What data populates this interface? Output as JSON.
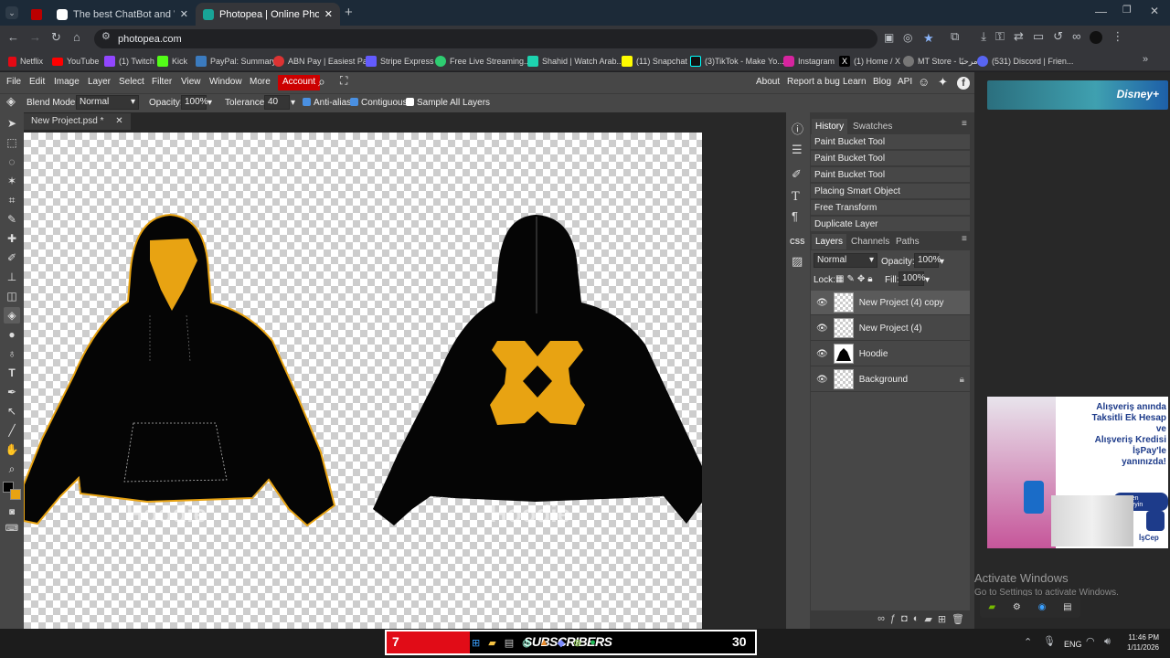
{
  "browser": {
    "tabs": [
      {
        "title": "The best ChatBot and Widgets"
      },
      {
        "title": "Photopea | Online Photo Editor"
      }
    ],
    "url": "photopea.com",
    "bookmarks": [
      "Netflix",
      "YouTube",
      "(1) Twitch",
      "Kick",
      "PayPal: Summary",
      "ABN Pay | Easiest Pa...",
      "Stripe Express",
      "Free Live Streaming...",
      "Shahid | Watch Arab...",
      "(11) Snapchat",
      "(3)TikTok - Make Yo...",
      "Instagram",
      "(1) Home / X",
      "MT Store - مرحبًا",
      "(531) Discord | Frien..."
    ]
  },
  "app": {
    "menu": [
      "File",
      "Edit",
      "Image",
      "Layer",
      "Select",
      "Filter",
      "View",
      "Window",
      "More"
    ],
    "account_label": "Account",
    "right_menu": [
      "About",
      "Report a bug",
      "Learn",
      "Blog",
      "API"
    ],
    "options": {
      "blend_label": "Blend Mode:",
      "blend_value": "Normal",
      "opacity_label": "Opacity:",
      "opacity_value": "100%",
      "tolerance_label": "Tolerance:",
      "tolerance_value": "40",
      "anti_alias": "Anti-alias",
      "contiguous": "Contiguous",
      "sample_all": "Sample All Layers"
    },
    "document_tab": "New Project.psd *",
    "canvas_captions": [
      "Hoodie",
      "Hoodie"
    ],
    "history": {
      "tabs": [
        "History",
        "Swatches"
      ],
      "items": [
        "Paint Bucket Tool",
        "Paint Bucket Tool",
        "Paint Bucket Tool",
        "Placing Smart Object",
        "Free Transform",
        "Duplicate Layer"
      ]
    },
    "layers": {
      "tabs": [
        "Layers",
        "Channels",
        "Paths"
      ],
      "blend_value": "Normal",
      "opacity_label": "Opacity:",
      "opacity_value": "100%",
      "lock_label": "Lock:",
      "fill_label": "Fill:",
      "fill_value": "100%",
      "items": [
        "New Project (4) copy",
        "New Project (4)",
        "Hoodie",
        "Background"
      ]
    },
    "side_css_label": "CSS"
  },
  "ads": {
    "top_text": "Disney+",
    "side_lines": [
      "Alışveriş anında",
      "Taksitli Ek Hesap ve",
      "Alışveriş Kredisi",
      "İşPay'le yanınızda!"
    ],
    "side_button": "Hemen inceleyin",
    "side_brand": "İşCep"
  },
  "watermark": {
    "title": "Activate Windows",
    "subtitle": "Go to Settings to activate Windows."
  },
  "taskbar": {
    "counter_left": "7",
    "banner_text": "SUBSCRIBERS",
    "counter_right": "30",
    "language": "ENG",
    "time": "11:46 PM",
    "date": "1/11/2026"
  },
  "colors": {
    "accent_orange": "#E8A312",
    "account_red": "#CC0000"
  }
}
